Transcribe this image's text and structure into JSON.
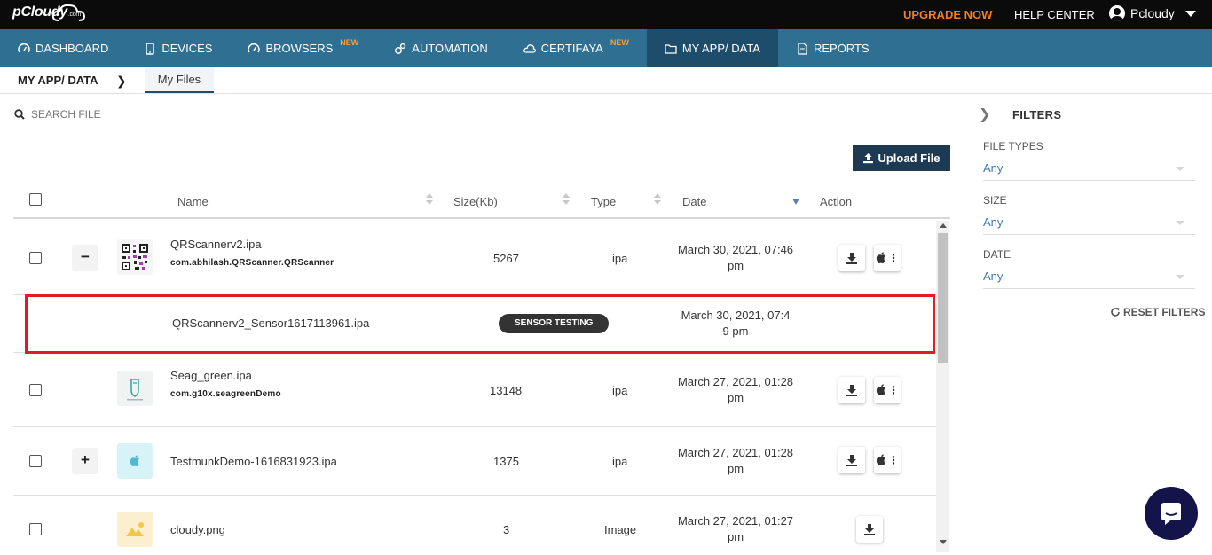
{
  "topbar": {
    "logo_text": "pCloudy",
    "logo_suffix": ".com",
    "upgrade_label": "UPGRADE NOW",
    "help_label": "HELP CENTER",
    "user_name": "Pcloudy"
  },
  "nav": {
    "items": [
      {
        "label": "DASHBOARD",
        "icon": "gauge-icon",
        "new": ""
      },
      {
        "label": "DEVICES",
        "icon": "mobile-icon",
        "new": ""
      },
      {
        "label": "BROWSERS",
        "icon": "gauge-icon",
        "new": "NEW"
      },
      {
        "label": "AUTOMATION",
        "icon": "gears-icon",
        "new": ""
      },
      {
        "label": "CERTIFAYA",
        "icon": "cloud-icon",
        "new": "NEW"
      },
      {
        "label": "MY APP/ DATA",
        "icon": "folder-icon",
        "new": ""
      },
      {
        "label": "REPORTS",
        "icon": "report-icon",
        "new": ""
      }
    ],
    "active_index": 5
  },
  "breadcrumb": {
    "root": "MY APP/ DATA",
    "current": "My Files"
  },
  "search": {
    "placeholder": "SEARCH FILE"
  },
  "upload": {
    "label": "Upload File"
  },
  "table": {
    "columns": [
      "Name",
      "Size(Kb)",
      "Type",
      "Date",
      "Action"
    ],
    "rows": [
      {
        "toggle": "−",
        "thumb": "qr-code-thumb",
        "name": "QRScannerv2.ipa",
        "package": "com.abhilash.QRScanner.QRScanner",
        "size": "5267",
        "type": "ipa",
        "date_line1": "March 30, 2021, 07:46",
        "date_line2": "pm",
        "actions": [
          "download",
          "ios-menu"
        ]
      },
      {
        "child": true,
        "name": "QRScannerv2_Sensor1617113961.ipa",
        "badge": "SENSOR TESTING",
        "date_line1": "March 30, 2021, 07:4",
        "date_line2": "9 pm"
      },
      {
        "toggle": "",
        "thumb": "seagreen-thumb",
        "name": "Seag_green.ipa",
        "package": "com.g10x.seagreenDemo",
        "size": "13148",
        "type": "ipa",
        "date_line1": "March 27, 2021, 01:28",
        "date_line2": "pm",
        "actions": [
          "download",
          "ios-menu"
        ]
      },
      {
        "toggle": "+",
        "thumb": "apple-thumb",
        "name": "TestmunkDemo-1616831923.ipa",
        "package": "",
        "size": "1375",
        "type": "ipa",
        "date_line1": "March 27, 2021, 01:28",
        "date_line2": "pm",
        "actions": [
          "download",
          "ios-menu"
        ]
      },
      {
        "toggle": "",
        "thumb": "image-thumb",
        "name": "cloudy.png",
        "package": "",
        "size": "3",
        "type": "Image",
        "date_line1": "March 27, 2021, 01:27",
        "date_line2": "pm",
        "actions": [
          "download"
        ]
      }
    ]
  },
  "filters": {
    "title": "FILTERS",
    "groups": [
      {
        "label": "FILE TYPES",
        "value": "Any"
      },
      {
        "label": "SIZE",
        "value": "Any"
      },
      {
        "label": "DATE",
        "value": "Any"
      }
    ],
    "reset_label": "RESET FILTERS"
  },
  "colors": {
    "topbar": "#0b0b0b",
    "nav": "#2f6f92",
    "nav_active": "#1d4d6b",
    "upgrade": "#f47f20",
    "highlight": "#e01b24",
    "upload_btn": "#1e3a52",
    "filter_value": "#3c78b4",
    "chat": "#14144a"
  }
}
